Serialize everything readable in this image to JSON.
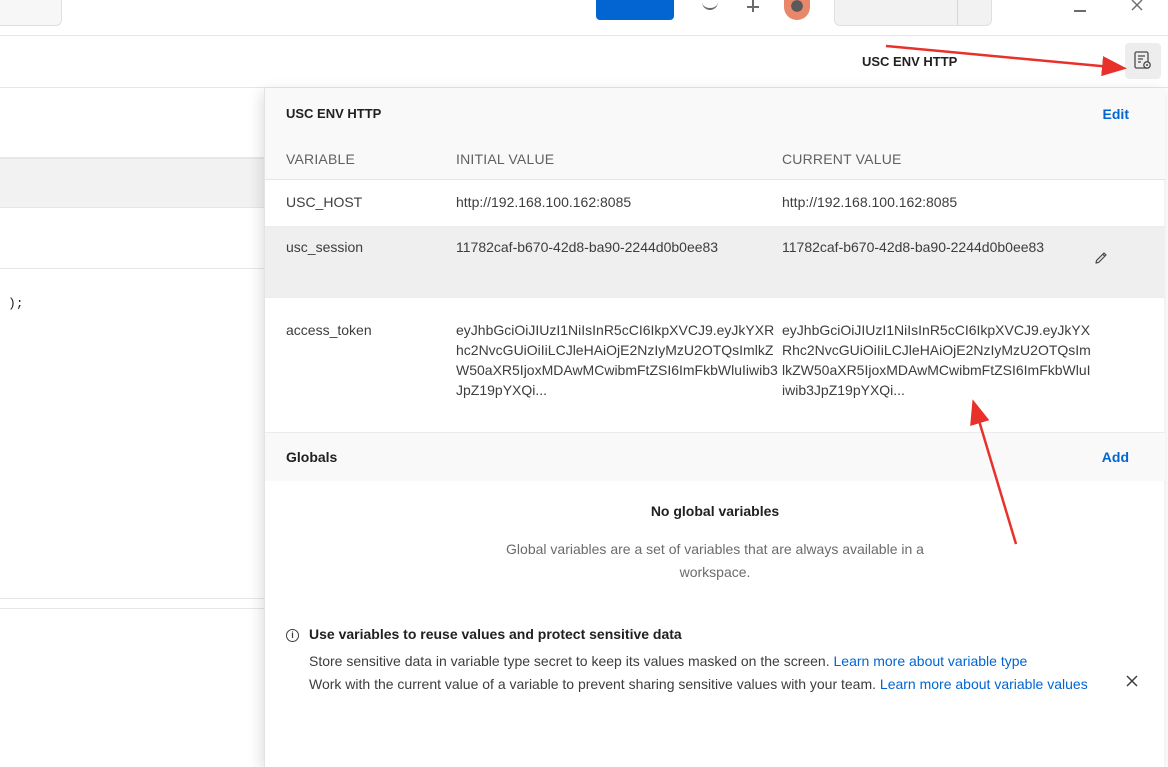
{
  "environment": {
    "selected_name": "USC ENV HTTP",
    "quick_look_icon": "environment-quick-look-icon"
  },
  "quick_look": {
    "title": "USC ENV HTTP",
    "edit_label": "Edit",
    "columns": {
      "variable": "VARIABLE",
      "initial": "INITIAL VALUE",
      "current": "CURRENT VALUE"
    },
    "rows": [
      {
        "name": "USC_HOST",
        "initial": "http://192.168.100.162:8085",
        "current": "http://192.168.100.162:8085"
      },
      {
        "name": "usc_session",
        "initial": "11782caf-b670-42d8-ba90-2244d0b0ee83",
        "current": "11782caf-b670-42d8-ba90-2244d0b0ee83"
      },
      {
        "name": "access_token",
        "initial": "eyJhbGciOiJIUzI1NiIsInR5cCI6IkpXVCJ9.eyJkYXRhc2NvcGUiOiIiLCJleHAiOjE2NzIyMzU2OTQsImlkZW50aXR5IjoxMDAwMCwibmFtZSI6ImFkbWluIiwib3JpZ19pYXQi...",
        "current": "eyJhbGciOiJIUzI1NiIsInR5cCI6IkpXVCJ9.eyJkYXRhc2NvcGUiOiIiLCJleHAiOjE2NzIyMzU2OTQsImlkZW50aXR5IjoxMDAwMCwibmFtZSI6ImFkbWluIiwib3JpZ19pYXQi..."
      }
    ]
  },
  "globals": {
    "title": "Globals",
    "add_label": "Add",
    "empty_title": "No global variables",
    "empty_desc": "Global variables are a set of variables that are always available in a workspace."
  },
  "tip": {
    "title": "Use variables to reuse values and protect sensitive data",
    "line1": "Store sensitive data in variable type secret to keep its values masked on the screen. ",
    "link1": "Learn more about variable type",
    "line2": "Work with the current value of a variable to prevent sharing sensitive values with your team. ",
    "link2": "Learn more about variable values"
  },
  "background": {
    "code_fragment": ");"
  },
  "colors": {
    "accent": "#0265d2",
    "annotation": "#e8312a"
  }
}
